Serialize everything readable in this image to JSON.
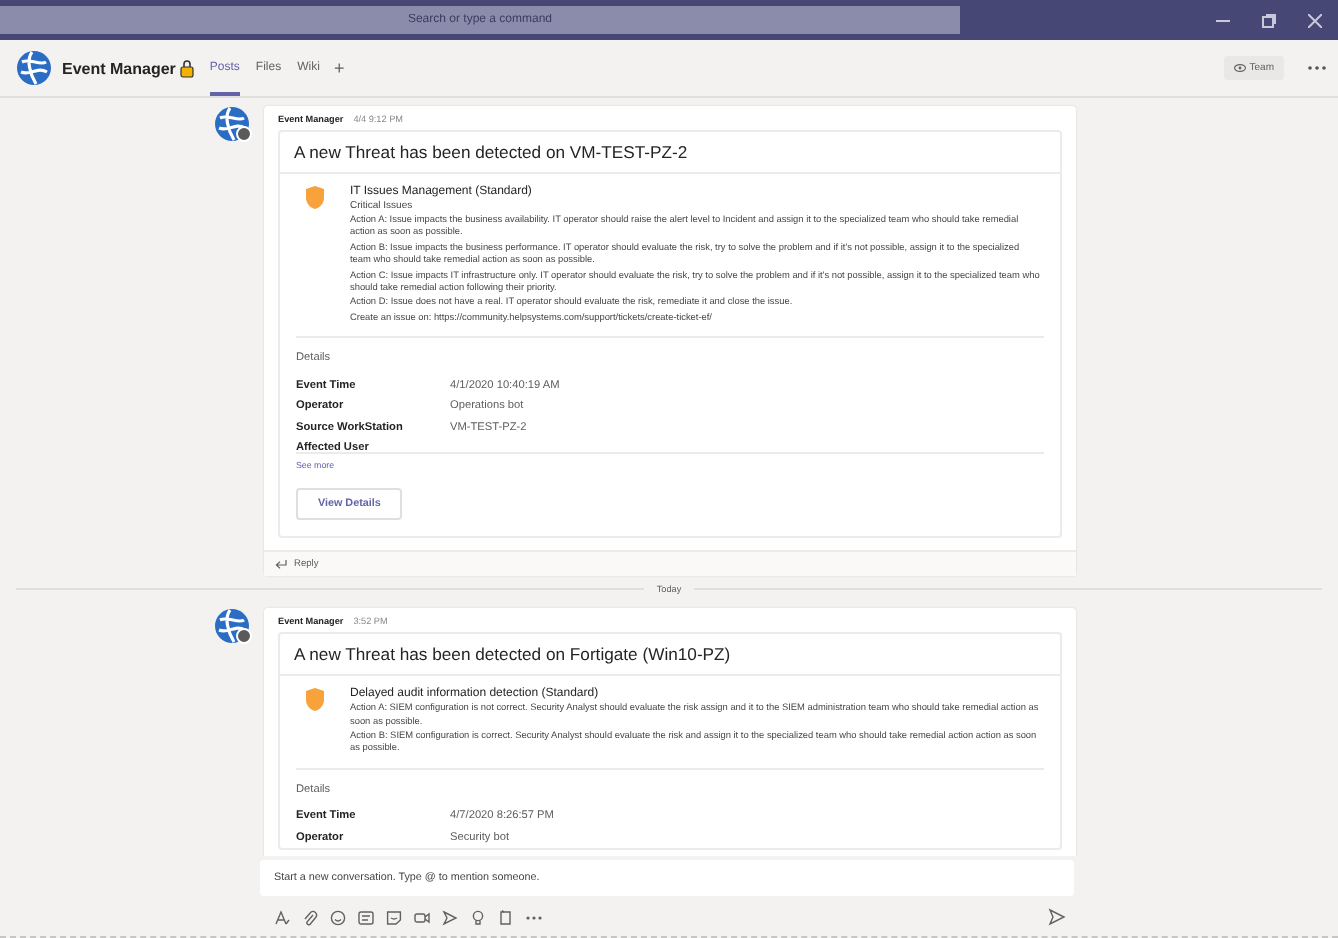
{
  "titlebar": {
    "search_placeholder": "Search or type a command"
  },
  "channel": {
    "name": "Event Manager",
    "tabs": [
      {
        "label": "Posts",
        "selected": true
      },
      {
        "label": "Files",
        "selected": false
      },
      {
        "label": "Wiki",
        "selected": false
      }
    ],
    "add_tab": "+",
    "team_button": "Team"
  },
  "feed": [
    {
      "kind": "post",
      "author": "Event Manager",
      "time": "4/4 9:12 PM",
      "card_title": "A new Threat has been detected on VM-TEST-PZ-2",
      "alert_title": "IT Issues Management (Standard)",
      "alert_subtitle": "Critical Issues",
      "alert_lines": [
        "Action A: Issue impacts the business availability. IT operator should raise the alert level to Incident and assign it to the specialized team who should take remedial action as soon as possible.",
        "Action B: Issue impacts the business performance. IT operator should evaluate the risk, try to solve the problem and if it's not possible, assign it to the specialized team who should take remedial action as soon as possible.",
        "Action C: Issue impacts IT infrastructure only. IT operator should evaluate the risk, try to solve the problem and if it's not possible, assign it to the specialized team who should take remedial action following their priority.",
        "Action D: Issue does not have a real. IT operator should evaluate the risk, remediate it and close the issue.",
        "Create an issue on: https://community.helpsystems.com/support/tickets/create-ticket-ef/"
      ],
      "details_label": "Details",
      "details": [
        {
          "label": "Event Time",
          "value": "4/1/2020 10:40:19 AM"
        },
        {
          "label": "Operator",
          "value": "Operations bot"
        },
        {
          "label": "Source WorkStation",
          "value": "VM-TEST-PZ-2"
        },
        {
          "label": "Affected User"
        }
      ],
      "see_more": "See more",
      "button": "View Details",
      "reply": "Reply"
    },
    {
      "kind": "divider",
      "label": "Today"
    },
    {
      "kind": "post",
      "author": "Event Manager",
      "time": "3:52 PM",
      "card_title": "A new Threat has been detected on Fortigate (Win10-PZ)",
      "alert_title": "Delayed audit information detection (Standard)",
      "alert_lines": [
        "Action A: SIEM configuration is not correct. Security Analyst should evaluate the risk assign and it to the SIEM administration team who should take remedial action as soon as possible.",
        "Action B: SIEM configuration is correct. Security Analyst should evaluate the risk and assign it to the specialized team who should take remedial action action as soon as possible."
      ],
      "details_label": "Details",
      "details": [
        {
          "label": "Event Time",
          "value": "4/7/2020 8:26:57 PM"
        },
        {
          "label": "Operator",
          "value": "Security bot"
        }
      ]
    }
  ],
  "compose": {
    "placeholder": "Start a new conversation. Type @ to mention someone."
  }
}
